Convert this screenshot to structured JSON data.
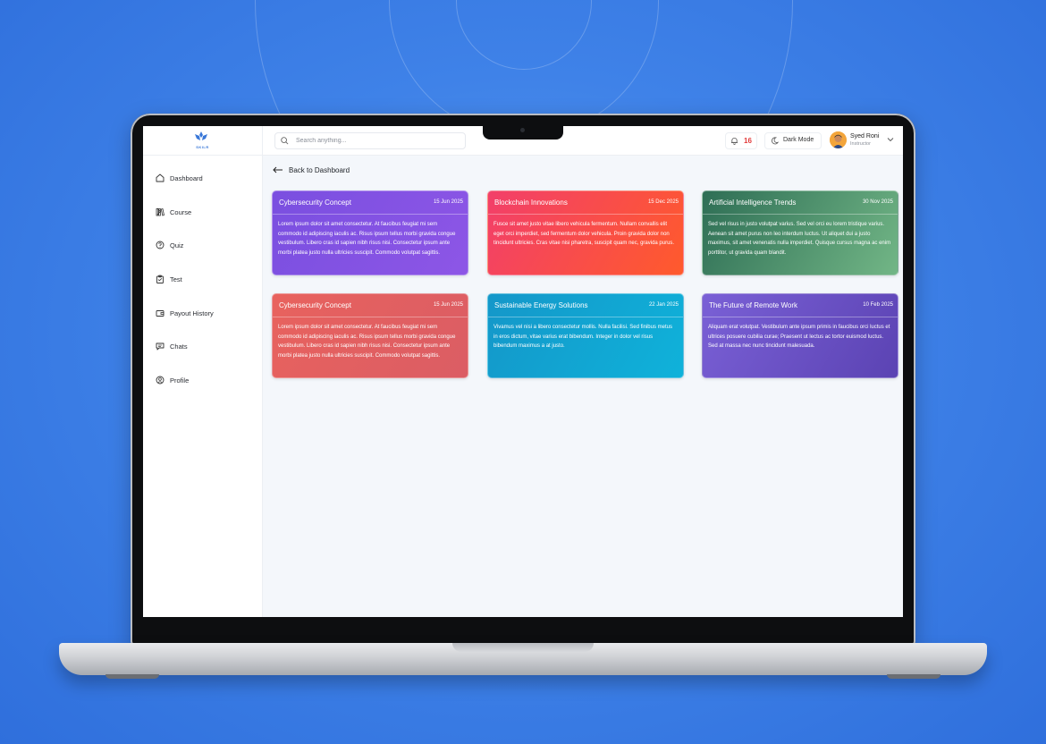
{
  "app": {
    "logo_text": "SKILR",
    "search_placeholder": "Search anything...",
    "notification_count": "16",
    "dark_mode_label": "Dark Mode",
    "user": {
      "name": "Syed Roni",
      "role": "Instructor"
    }
  },
  "sidebar": {
    "items": [
      {
        "label": "Dashboard",
        "icon": "home-icon"
      },
      {
        "label": "Course",
        "icon": "books-icon",
        "has_submenu": true
      },
      {
        "label": "Quiz",
        "icon": "question-circle-icon"
      },
      {
        "label": "Test",
        "icon": "clipboard-icon"
      },
      {
        "label": "Payout History",
        "icon": "wallet-icon"
      },
      {
        "label": "Chats",
        "icon": "chat-icon"
      },
      {
        "label": "Profile",
        "icon": "user-circle-icon"
      }
    ]
  },
  "main": {
    "back_label": "Back to Dashboard",
    "cards": [
      {
        "title": "Cybersecurity Concept",
        "date": "15 Jun 2025",
        "body": "Lorem ipsum dolor sit amet consectetur. At faucibus feugiat mi sem commodo id adipiscing iaculis ac. Risus ipsum tellus morbi gravida congue vestibulum. Libero cras id sapien nibh risus nisi. Consectetur ipsum ante morbi platea justo nulla ultricies suscipit. Commodo volutpat sagittis.",
        "gradient": [
          "#7a4fe0",
          "#8d56e6"
        ]
      },
      {
        "title": "Blockchain Innovations",
        "date": "15 Dec 2025",
        "body": "Fusce sit amet justo vitae libero vehicula fermentum. Nullam convallis elit eget orci imperdiet, sed fermentum dolor vehicula. Proin gravida dolor non tincidunt ultricies. Cras vitae nisi pharetra, suscipit quam nec, gravida purus.",
        "gradient": [
          "#f23f6a",
          "#ff5a2c"
        ]
      },
      {
        "title": "Artificial Intelligence Trends",
        "date": "30 Nov 2025",
        "body": "Sed vel risus in justo volutpat varius. Sed vel orci eu lorem tristique varius. Aenean sit amet purus non leo interdum luctus. Ut aliquet dui a justo maximus, sit amet venenatis nulla imperdiet. Quisque cursus magna ac enim porttitor, ut gravida quam blandit.",
        "gradient": [
          "#2e6e55",
          "#72b686"
        ]
      },
      {
        "title": "Cybersecurity Concept",
        "date": "15 Jun 2025",
        "body": "Lorem ipsum dolor sit amet consectetur. At faucibus feugiat mi sem commodo id adipiscing iaculis ac. Risus ipsum tellus morbi gravida congue vestibulum. Libero cras id sapien nibh risus nisi. Consectetur ipsum ante morbi platea justo nulla ultricies suscipit. Commodo volutpat sagittis.",
        "gradient": [
          "#e8625e",
          "#db5d64"
        ]
      },
      {
        "title": "Sustainable Energy Solutions",
        "date": "22 Jan 2025",
        "body": "Vivamus vel nisi a libero consectetur mollis. Nulla facilisi. Sed finibus metus in eros dictum, vitae varius erat bibendum. Integer in dolor vel risus bibendum maximus a at justo.",
        "gradient": [
          "#1497c9",
          "#0fb2da"
        ]
      },
      {
        "title": "The Future of Remote Work",
        "date": "10 Feb 2025",
        "body": "Aliquam erat volutpat. Vestibulum ante ipsum primis in faucibus orci luctus et ultrices posuere cubilia curae; Praesent ut lectus ac tortor euismod luctus. Sed at massa nec nunc tincidunt malesuada.",
        "gradient": [
          "#7a60d6",
          "#5b43b3"
        ]
      }
    ]
  }
}
